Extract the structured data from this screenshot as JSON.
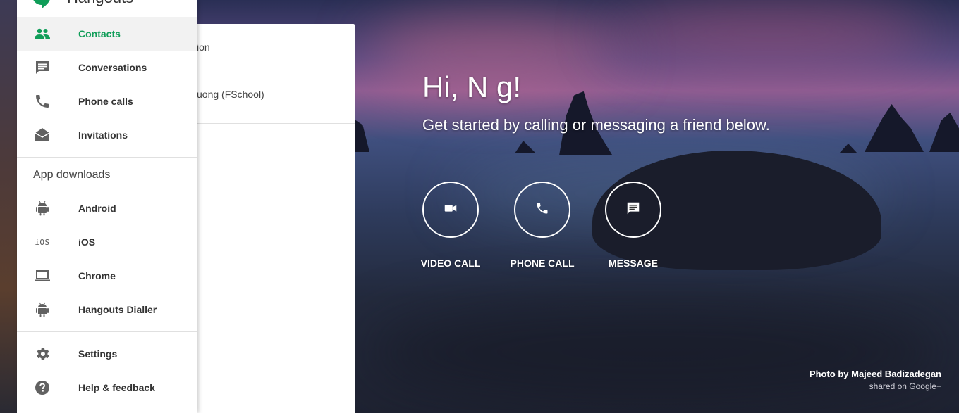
{
  "app": {
    "title": "Hangouts",
    "accent": "#0f9d58"
  },
  "drawer": {
    "items": [
      {
        "label": "Contacts",
        "icon": "contacts-icon",
        "active": true
      },
      {
        "label": "Conversations",
        "icon": "conversations-icon"
      },
      {
        "label": "Phone calls",
        "icon": "phone-icon"
      },
      {
        "label": "Invitations",
        "icon": "invitations-icon"
      }
    ],
    "downloads_title": "App downloads",
    "downloads": [
      {
        "label": "Android",
        "icon": "android-icon"
      },
      {
        "label": "iOS",
        "icon": "ios-icon",
        "icon_text": "iOS"
      },
      {
        "label": "Chrome",
        "icon": "laptop-icon"
      },
      {
        "label": "Hangouts Dialler",
        "icon": "android-icon"
      }
    ],
    "footer": [
      {
        "label": "Settings",
        "icon": "gear-icon"
      },
      {
        "label": "Help & feedback",
        "icon": "help-icon"
      }
    ]
  },
  "list_panel": {
    "row1_partial": "ion",
    "row2_partial": "uong (FSchool)"
  },
  "welcome": {
    "greeting": "Hi, N g!",
    "subtitle": "Get started by calling or messaging a friend below.",
    "actions": [
      {
        "label": "VIDEO CALL",
        "icon": "video-camera-icon"
      },
      {
        "label": "PHONE CALL",
        "icon": "phone-icon"
      },
      {
        "label": "MESSAGE",
        "icon": "message-icon"
      }
    ]
  },
  "credit": {
    "photo_by": "Photo by Majeed Badizadegan",
    "shared_on": "shared on Google+"
  }
}
